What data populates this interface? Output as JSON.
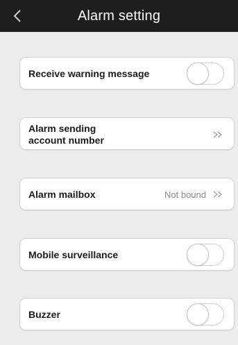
{
  "header": {
    "title": "Alarm setting"
  },
  "items": [
    {
      "label": "Receive warning message",
      "type": "toggle",
      "enabled": false
    },
    {
      "label": "Alarm sending\naccount number",
      "type": "link"
    },
    {
      "label": "Alarm mailbox",
      "type": "link",
      "value": "Not bound"
    },
    {
      "label": "Mobile surveillance",
      "type": "toggle",
      "enabled": false
    },
    {
      "label": "Buzzer",
      "type": "toggle",
      "enabled": false
    }
  ],
  "icons": {
    "back": "chevron-left-icon",
    "forward": "double-chevron-right-icon"
  },
  "colors": {
    "header_bg": "#1e1e1e",
    "page_bg": "#ececec",
    "card_bg": "#ffffff",
    "muted_text": "#8a8a8a"
  }
}
